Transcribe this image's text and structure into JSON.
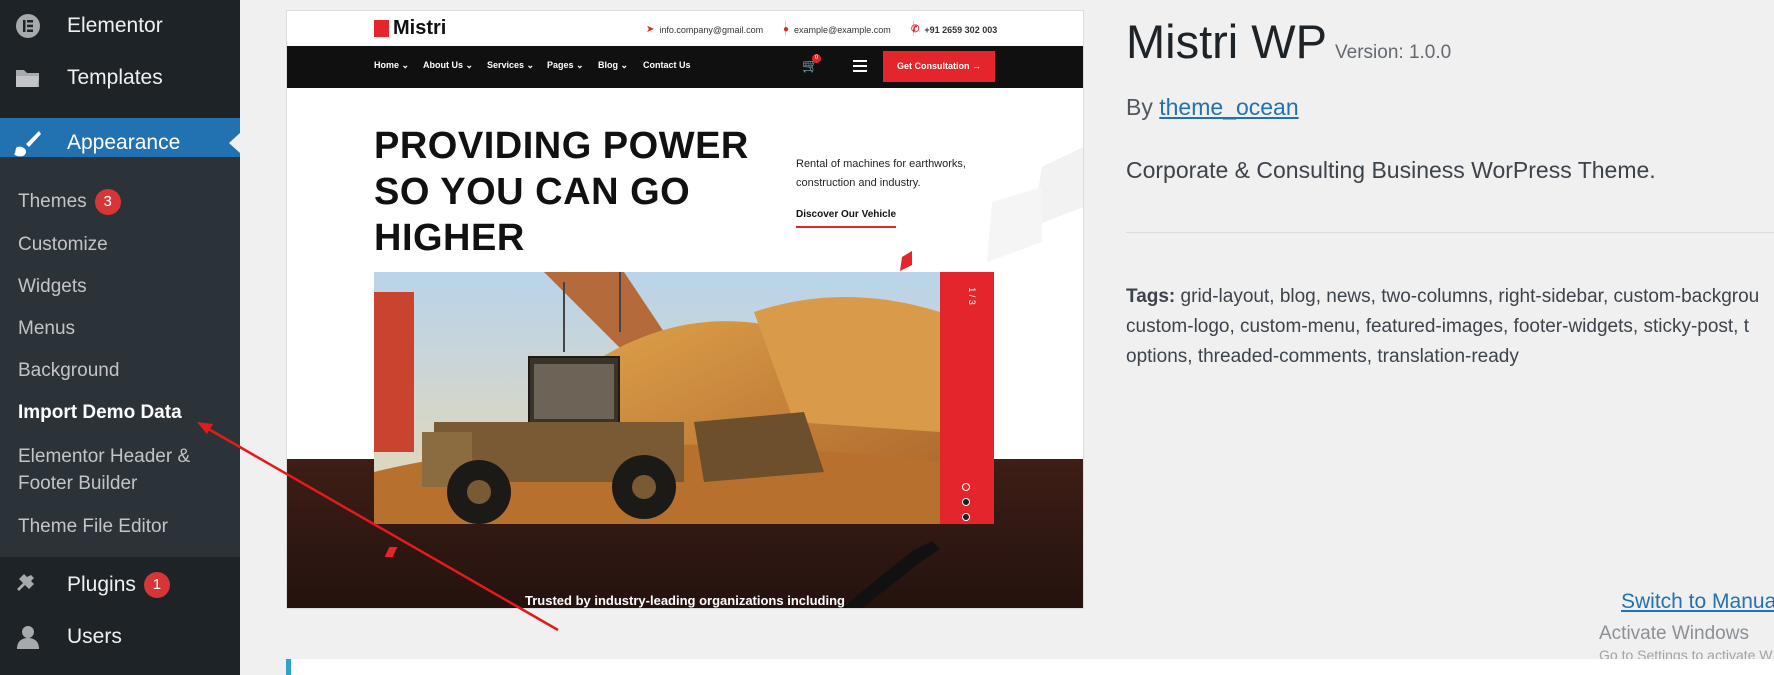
{
  "sidebar": {
    "top_items": [
      {
        "label": "Elementor",
        "icon": "elementor-icon"
      },
      {
        "label": "Templates",
        "icon": "folder-icon"
      },
      {
        "label": "Appearance",
        "icon": "paintbrush-icon",
        "active": true
      }
    ],
    "submenu": [
      {
        "label": "Themes",
        "count": "3"
      },
      {
        "label": "Customize"
      },
      {
        "label": "Widgets"
      },
      {
        "label": "Menus"
      },
      {
        "label": "Background"
      },
      {
        "label": "Import Demo Data",
        "current": true
      },
      {
        "label": "Elementor Header &\nFooter Builder"
      },
      {
        "label": "Theme File Editor"
      }
    ],
    "bottom_items": [
      {
        "label": "Plugins",
        "icon": "plug-icon",
        "count": "1"
      },
      {
        "label": "Users",
        "icon": "user-icon"
      }
    ],
    "active_color": "#2271b1"
  },
  "preview": {
    "logo": "Mistri",
    "email": "info.company@gmail.com",
    "location": "example@example.com",
    "phone": "+91 2659 302 003",
    "nav": [
      "Home",
      "About Us",
      "Services",
      "Pages",
      "Blog",
      "Contact Us"
    ],
    "cart_count": "0",
    "cta": "Get Consultation",
    "headline": [
      "PROVIDING POWER",
      "SO YOU CAN GO",
      "HIGHER"
    ],
    "description": "Rental of machines for earthworks, construction and industry.",
    "discover": "Discover Our Vehicle",
    "slide_counter": "1 / 3",
    "trusted": "Trusted by industry-leading organizations including",
    "accent_color": "#e4262c"
  },
  "theme": {
    "name": "Mistri WP",
    "version": "Version: 1.0.0",
    "by_prefix": "By",
    "author": "theme_ocean",
    "description": "Corporate & Consulting Business WorPress Theme.",
    "tags_label": "Tags:",
    "tags_lines": [
      "grid-layout, blog, news, two-columns, right-sidebar, custom-backgrou",
      "custom-logo, custom-menu, featured-images, footer-widgets, sticky-post, t",
      "options, threaded-comments, translation-ready"
    ]
  },
  "footer": {
    "switch_link": "Switch to Manua",
    "activate_title": "Activate Windows",
    "activate_sub": "Go to Settings to activate W"
  }
}
